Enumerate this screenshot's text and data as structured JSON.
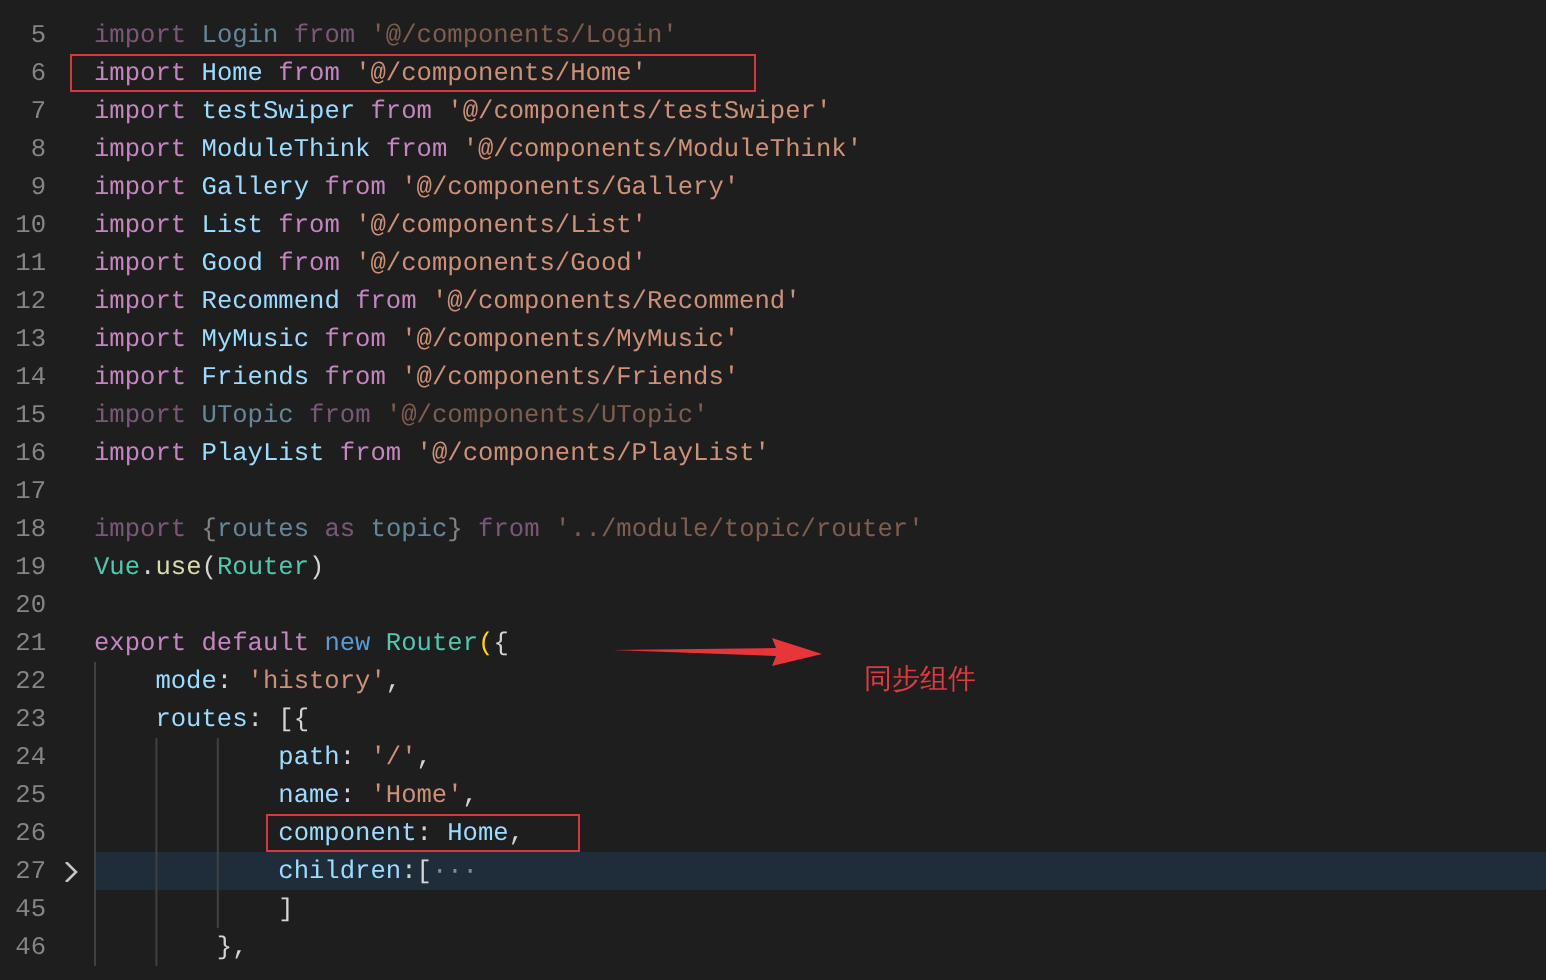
{
  "editor": {
    "lines": [
      {
        "number": "5",
        "faded": true,
        "boxed": false,
        "current": false,
        "tokens": [
          {
            "kind": "keyword",
            "text": "import "
          },
          {
            "kind": "variable",
            "text": "Login "
          },
          {
            "kind": "keyword",
            "text": "from "
          },
          {
            "kind": "string",
            "text": "'@/components/Login'"
          }
        ]
      },
      {
        "number": "6",
        "faded": false,
        "boxed": true,
        "current": false,
        "tokens": [
          {
            "kind": "keyword",
            "text": "import "
          },
          {
            "kind": "variable",
            "text": "Home "
          },
          {
            "kind": "keyword",
            "text": "from "
          },
          {
            "kind": "string",
            "text": "'@/components/Home'"
          }
        ]
      },
      {
        "number": "7",
        "faded": false,
        "boxed": false,
        "current": false,
        "tokens": [
          {
            "kind": "keyword",
            "text": "import "
          },
          {
            "kind": "variable",
            "text": "testSwiper "
          },
          {
            "kind": "keyword",
            "text": "from "
          },
          {
            "kind": "string",
            "text": "'@/components/testSwiper'"
          }
        ]
      },
      {
        "number": "8",
        "faded": false,
        "boxed": false,
        "current": false,
        "tokens": [
          {
            "kind": "keyword",
            "text": "import "
          },
          {
            "kind": "variable",
            "text": "ModuleThink "
          },
          {
            "kind": "keyword",
            "text": "from "
          },
          {
            "kind": "string",
            "text": "'@/components/ModuleThink'"
          }
        ]
      },
      {
        "number": "9",
        "faded": false,
        "boxed": false,
        "current": false,
        "tokens": [
          {
            "kind": "keyword",
            "text": "import "
          },
          {
            "kind": "variable",
            "text": "Gallery "
          },
          {
            "kind": "keyword",
            "text": "from "
          },
          {
            "kind": "string",
            "text": "'@/components/Gallery'"
          }
        ]
      },
      {
        "number": "10",
        "faded": false,
        "boxed": false,
        "current": false,
        "tokens": [
          {
            "kind": "keyword",
            "text": "import "
          },
          {
            "kind": "variable",
            "text": "List "
          },
          {
            "kind": "keyword",
            "text": "from "
          },
          {
            "kind": "string",
            "text": "'@/components/List'"
          }
        ]
      },
      {
        "number": "11",
        "faded": false,
        "boxed": false,
        "current": false,
        "tokens": [
          {
            "kind": "keyword",
            "text": "import "
          },
          {
            "kind": "variable",
            "text": "Good "
          },
          {
            "kind": "keyword",
            "text": "from "
          },
          {
            "kind": "string",
            "text": "'@/components/Good'"
          }
        ]
      },
      {
        "number": "12",
        "faded": false,
        "boxed": false,
        "current": false,
        "tokens": [
          {
            "kind": "keyword",
            "text": "import "
          },
          {
            "kind": "variable",
            "text": "Recommend "
          },
          {
            "kind": "keyword",
            "text": "from "
          },
          {
            "kind": "string",
            "text": "'@/components/Recommend'"
          }
        ]
      },
      {
        "number": "13",
        "faded": false,
        "boxed": false,
        "current": false,
        "tokens": [
          {
            "kind": "keyword",
            "text": "import "
          },
          {
            "kind": "variable",
            "text": "MyMusic "
          },
          {
            "kind": "keyword",
            "text": "from "
          },
          {
            "kind": "string",
            "text": "'@/components/MyMusic'"
          }
        ]
      },
      {
        "number": "14",
        "faded": false,
        "boxed": false,
        "current": false,
        "tokens": [
          {
            "kind": "keyword",
            "text": "import "
          },
          {
            "kind": "variable",
            "text": "Friends "
          },
          {
            "kind": "keyword",
            "text": "from "
          },
          {
            "kind": "string",
            "text": "'@/components/Friends'"
          }
        ]
      },
      {
        "number": "15",
        "faded": true,
        "boxed": false,
        "current": false,
        "tokens": [
          {
            "kind": "keyword",
            "text": "import "
          },
          {
            "kind": "variable",
            "text": "UTopic "
          },
          {
            "kind": "keyword",
            "text": "from "
          },
          {
            "kind": "string",
            "text": "'@/components/UTopic'"
          }
        ]
      },
      {
        "number": "16",
        "faded": false,
        "boxed": false,
        "current": false,
        "tokens": [
          {
            "kind": "keyword",
            "text": "import "
          },
          {
            "kind": "variable",
            "text": "PlayList "
          },
          {
            "kind": "keyword",
            "text": "from "
          },
          {
            "kind": "string",
            "text": "'@/components/PlayList'"
          }
        ]
      },
      {
        "number": "17",
        "current": false
      },
      {
        "number": "18",
        "faded": true,
        "boxed": false,
        "current": false,
        "tokens": [
          {
            "kind": "keyword",
            "text": "import "
          },
          {
            "kind": "punct",
            "text": "{"
          },
          {
            "kind": "variable",
            "text": "routes "
          },
          {
            "kind": "keyword",
            "text": "as "
          },
          {
            "kind": "variable",
            "text": "topic"
          },
          {
            "kind": "punct",
            "text": "} "
          },
          {
            "kind": "keyword",
            "text": "from "
          },
          {
            "kind": "string",
            "text": "'../module/topic/router'"
          }
        ]
      },
      {
        "number": "19",
        "faded": false,
        "boxed": false,
        "current": false,
        "tokens": [
          {
            "kind": "class",
            "text": "Vue"
          },
          {
            "kind": "punct",
            "text": "."
          },
          {
            "kind": "function",
            "text": "use"
          },
          {
            "kind": "punct",
            "text": "("
          },
          {
            "kind": "class",
            "text": "Router"
          },
          {
            "kind": "punct",
            "text": ")"
          }
        ]
      },
      {
        "number": "20",
        "current": false
      },
      {
        "number": "21",
        "faded": false,
        "boxed": false,
        "current": false,
        "tokens": [
          {
            "kind": "keyword",
            "text": "export default "
          },
          {
            "kind": "storage",
            "text": "new "
          },
          {
            "kind": "class",
            "text": "Router"
          },
          {
            "kind": "bracket",
            "text": "("
          },
          {
            "kind": "punct",
            "text": "{"
          }
        ]
      },
      {
        "number": "22",
        "faded": false,
        "boxed": false,
        "current": false,
        "kind": "option",
        "tokens": [
          {
            "kind": "variable",
            "text": "mode"
          },
          {
            "kind": "punct",
            "text": ": "
          },
          {
            "kind": "string",
            "text": "'history'"
          },
          {
            "kind": "punct",
            "text": ","
          }
        ]
      },
      {
        "number": "23",
        "faded": false,
        "boxed": false,
        "current": false,
        "kind": "option",
        "tokens": [
          {
            "kind": "variable",
            "text": "routes"
          },
          {
            "kind": "punct",
            "text": ": [{"
          }
        ]
      },
      {
        "number": "24",
        "faded": false,
        "boxed": false,
        "current": false,
        "kind": "route-field",
        "tokens": [
          {
            "kind": "variable",
            "text": "path"
          },
          {
            "kind": "punct",
            "text": ": "
          },
          {
            "kind": "string",
            "text": "'/'"
          },
          {
            "kind": "punct",
            "text": ","
          }
        ]
      },
      {
        "number": "25",
        "faded": false,
        "boxed": false,
        "current": false,
        "kind": "route-field",
        "tokens": [
          {
            "kind": "variable",
            "text": "name"
          },
          {
            "kind": "punct",
            "text": ": "
          },
          {
            "kind": "string",
            "text": "'Home'"
          },
          {
            "kind": "punct",
            "text": ","
          }
        ]
      },
      {
        "number": "26",
        "faded": false,
        "boxed": true,
        "current": false,
        "kind": "route-field",
        "tokens": [
          {
            "kind": "variable",
            "text": "component"
          },
          {
            "kind": "punct",
            "text": ": "
          },
          {
            "kind": "variable",
            "text": "Home"
          },
          {
            "kind": "punct",
            "text": ","
          }
        ]
      },
      {
        "number": "27",
        "faded": false,
        "boxed": false,
        "current": true,
        "fold": {
          "expanded": false
        },
        "kind": "route-field",
        "tokens": [
          {
            "kind": "variable",
            "text": "children"
          },
          {
            "kind": "punct",
            "text": ":["
          },
          {
            "kind": "ellipsis",
            "text": "···"
          }
        ]
      },
      {
        "number": "45",
        "faded": false,
        "boxed": false,
        "current": false,
        "kind": "route-field",
        "tokens": [
          {
            "kind": "punct",
            "text": "]"
          }
        ]
      },
      {
        "number": "46",
        "faded": false,
        "boxed": false,
        "current": false,
        "kind": "route-end",
        "tokens": [
          {
            "kind": "punct",
            "text": "},"
          }
        ]
      }
    ]
  },
  "annotation": {
    "label": "同步组件"
  }
}
